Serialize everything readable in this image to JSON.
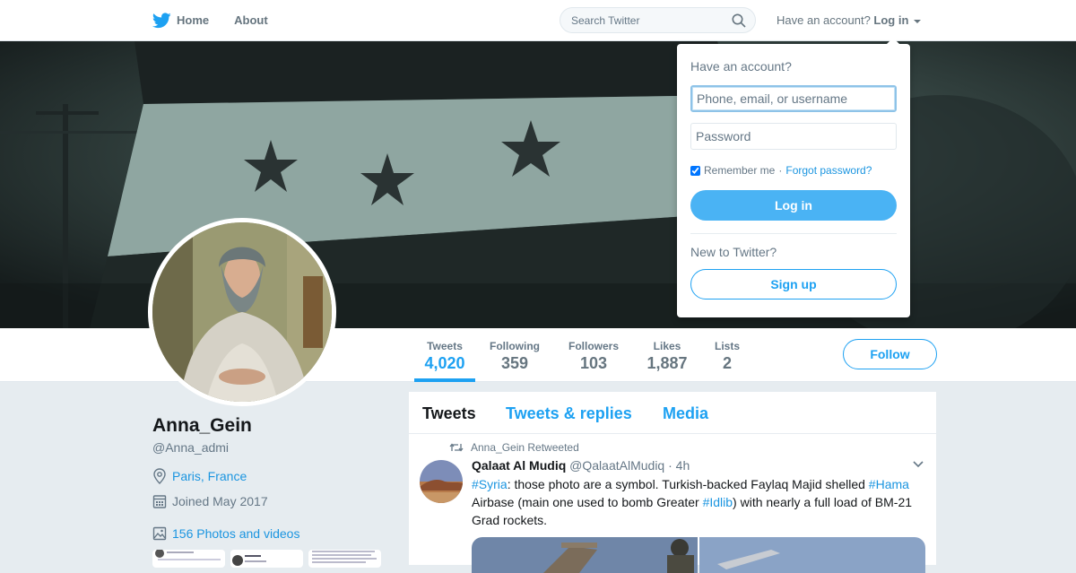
{
  "nav": {
    "home_label": "Home",
    "about_label": "About",
    "search_placeholder": "Search Twitter",
    "account_prompt": "Have an account?",
    "login_label": "Log in"
  },
  "profile": {
    "name": "Anna_Gein",
    "handle": "@Anna_admi",
    "location": "Paris, France",
    "joined": "Joined May 2017",
    "photos": "156 Photos and videos",
    "follow_label": "Follow"
  },
  "stats": [
    {
      "label": "Tweets",
      "value": "4,020"
    },
    {
      "label": "Following",
      "value": "359"
    },
    {
      "label": "Followers",
      "value": "103"
    },
    {
      "label": "Likes",
      "value": "1,887"
    },
    {
      "label": "Lists",
      "value": "2"
    }
  ],
  "timeline": {
    "tabs": [
      "Tweets",
      "Tweets & replies",
      "Media"
    ],
    "tweet": {
      "retweet_context": "Anna_Gein Retweeted",
      "author_name": "Qalaat Al Mudiq",
      "author_handle": "@QalaatAlMudiq",
      "time": "· 4h",
      "text_parts": [
        "#Syria",
        ": those photo are a symbol. Turkish-backed Faylaq Majid shelled ",
        "#Hama",
        " Airbase (main one used to bomb Greater ",
        "#Idlib",
        ") with nearly a full load of BM-21 Grad rockets."
      ]
    }
  },
  "login_dropdown": {
    "title": "Have an account?",
    "username_placeholder": "Phone, email, or username",
    "password_placeholder": "Password",
    "remember_label": "Remember me",
    "separator": "·",
    "forgot_label": "Forgot password?",
    "login_button": "Log in",
    "new_prompt": "New to Twitter?",
    "signup_button": "Sign up"
  },
  "colors": {
    "accent": "#1da1f2",
    "link": "#1b95e0",
    "page_bg": "#e6ecf0",
    "login_button": "#4ab3f4"
  },
  "icons": [
    "twitter-bird-icon",
    "search-icon",
    "caret-down-icon",
    "location-icon",
    "calendar-icon",
    "photo-icon",
    "retweet-icon",
    "chevron-down-icon"
  ]
}
